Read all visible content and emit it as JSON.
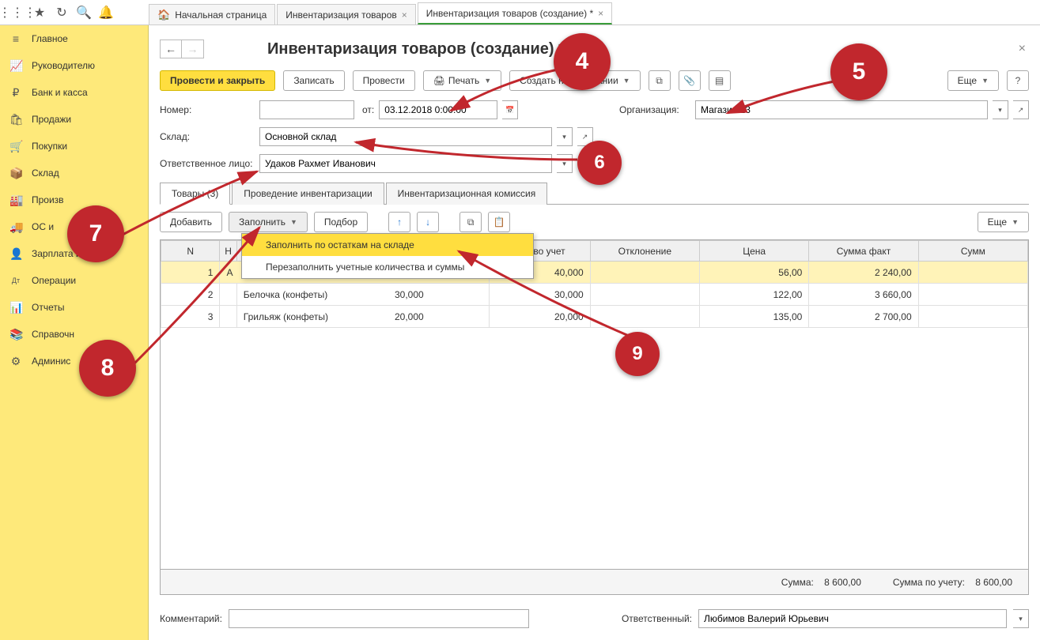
{
  "tabs": [
    {
      "label": "Начальная страница",
      "is_home": true
    },
    {
      "label": "Инвентаризация товаров",
      "closable": true
    },
    {
      "label": "Инвентаризация товаров (создание) *",
      "closable": true,
      "active": true
    }
  ],
  "sidebar": {
    "items": [
      {
        "icon": "≡",
        "label": "Главное"
      },
      {
        "icon": "📈",
        "label": "Руководителю"
      },
      {
        "icon": "₽",
        "label": "Банк и касса"
      },
      {
        "icon": "🛍",
        "label": "Продажи"
      },
      {
        "icon": "🛒",
        "label": "Покупки"
      },
      {
        "icon": "📦",
        "label": "Склад"
      },
      {
        "icon": "🏭",
        "label": "Произв"
      },
      {
        "icon": "🚚",
        "label": "ОС и"
      },
      {
        "icon": "👤",
        "label": "Зарплата и кадры"
      },
      {
        "icon": "Дт",
        "label": "Операции"
      },
      {
        "icon": "📊",
        "label": "Отчеты"
      },
      {
        "icon": "📚",
        "label": "Справочн"
      },
      {
        "icon": "⚙",
        "label": "Админис"
      }
    ]
  },
  "page": {
    "title": "Инвентаризация товаров (создание) *"
  },
  "actions": {
    "post_close": "Провести и закрыть",
    "save": "Записать",
    "post": "Провести",
    "print": "Печать",
    "create_based": "Создать на основании",
    "more": "Еще"
  },
  "form": {
    "number_label": "Номер:",
    "number_value": "",
    "date_label": "от:",
    "date_value": "03.12.2018 0:00:00",
    "org_label": "Организация:",
    "org_value": "Магазин 23",
    "warehouse_label": "Склад:",
    "warehouse_value": "Основной склад",
    "responsible_label": "Ответственное лицо:",
    "responsible_value": "Удаков Рахмет Иванович"
  },
  "doc_tabs": [
    {
      "label": "Товары (3)",
      "active": true
    },
    {
      "label": "Проведение инвентаризации"
    },
    {
      "label": "Инвентаризационная комиссия"
    }
  ],
  "table_toolbar": {
    "add": "Добавить",
    "fill": "Заполнить",
    "pick": "Подбор",
    "more": "Еще"
  },
  "fill_menu": {
    "item1": "Заполнить по остаткам на складе",
    "item2": "Перезаполнить учетные количества и суммы"
  },
  "table": {
    "columns": [
      "N",
      "Н",
      "",
      "Кол-во учет",
      "Отклонение",
      "Цена",
      "Сумма факт",
      "Сумм"
    ],
    "rows": [
      {
        "n": "1",
        "name": "А",
        "qty_fact": "",
        "qty_acc": "40,000",
        "dev": "",
        "price": "56,00",
        "sum_fact": "2 240,00"
      },
      {
        "n": "2",
        "name": "Белочка (конфеты)",
        "qty_fact": "30,000",
        "qty_acc": "30,000",
        "dev": "",
        "price": "122,00",
        "sum_fact": "3 660,00"
      },
      {
        "n": "3",
        "name": "Грильяж (конфеты)",
        "qty_fact": "20,000",
        "qty_acc": "20,000",
        "dev": "",
        "price": "135,00",
        "sum_fact": "2 700,00"
      }
    ]
  },
  "totals": {
    "sum_label": "Сумма:",
    "sum_value": "8 600,00",
    "sum_acc_label": "Сумма по учету:",
    "sum_acc_value": "8 600,00"
  },
  "footer": {
    "comment_label": "Комментарий:",
    "comment_value": "",
    "resp_label": "Ответственный:",
    "resp_value": "Любимов Валерий Юрьевич"
  },
  "bubbles": {
    "b4": "4",
    "b5": "5",
    "b6": "6",
    "b7": "7",
    "b8": "8",
    "b9": "9"
  }
}
